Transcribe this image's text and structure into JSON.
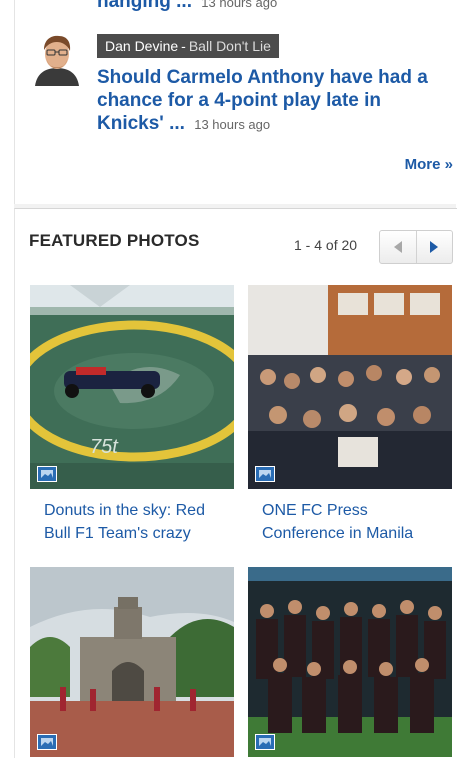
{
  "previous_story": {
    "headline_fragment": "hanging ...",
    "time": "13 hours ago"
  },
  "story": {
    "author_name": "Dan Devine",
    "separator": "-",
    "blog_name": "Ball Don't Lie",
    "headline": "Should Carmelo Anthony have had a chance for a 4-point play late in Knicks' ...",
    "time": "13 hours ago"
  },
  "more_label": "More »",
  "featured": {
    "title": "FEATURED PHOTOS",
    "pager_count": "1 - 4 of 20",
    "photos": [
      {
        "caption": "Donuts in the sky: Red Bull F1 Team's crazy"
      },
      {
        "caption": "ONE FC Press Conference in Manila"
      },
      {
        "caption": ""
      },
      {
        "caption": ""
      }
    ]
  },
  "colors": {
    "link": "#1d5aa6",
    "badge_bg": "#4c4c4c",
    "heading": "#2a2a2a"
  },
  "icons": [
    "avatar-photo",
    "left-arrow-icon",
    "right-arrow-icon",
    "photo-gallery-icon"
  ]
}
